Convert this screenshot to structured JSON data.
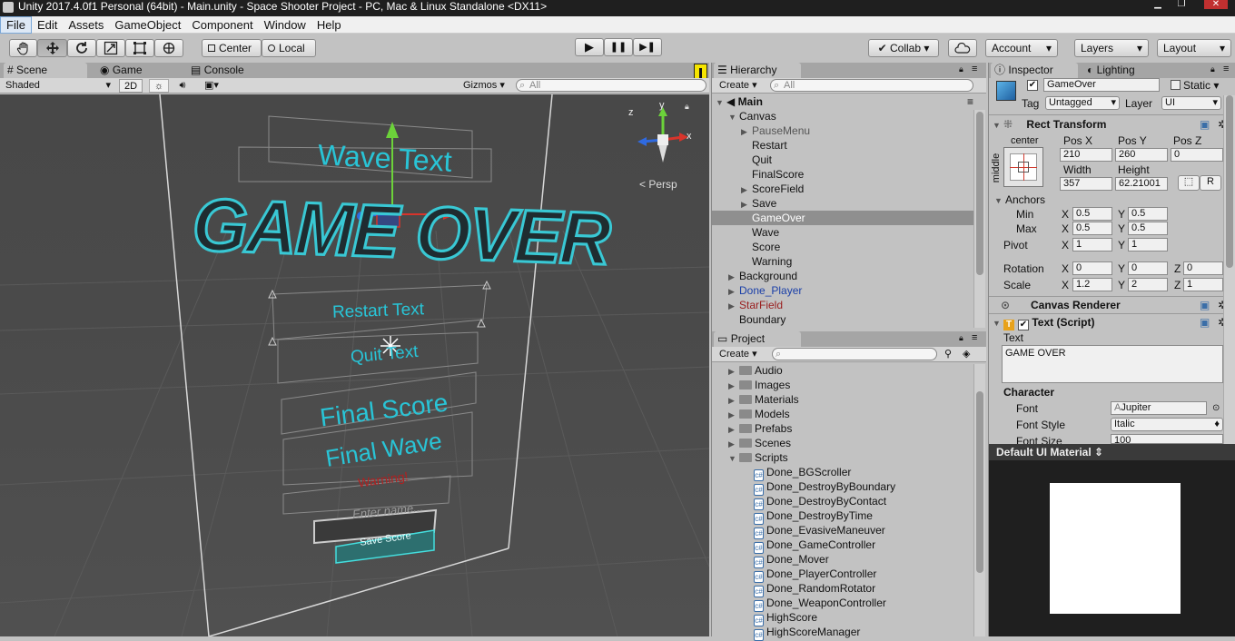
{
  "window": {
    "title": "Unity 2017.4.0f1 Personal (64bit) - Main.unity - Space Shooter Project - PC, Mac & Linux Standalone <DX11>",
    "controls": [
      "▁",
      "❐",
      "✕"
    ]
  },
  "menu": [
    "File",
    "Edit",
    "Assets",
    "GameObject",
    "Component",
    "Window",
    "Help"
  ],
  "toolbar": {
    "tools": [
      "hand-icon",
      "move-icon",
      "rotate-icon",
      "scale-icon",
      "rect-icon",
      "transform-icon"
    ],
    "pivot": "Center",
    "space": "Local",
    "play": "▶",
    "pause": "❚❚",
    "step": "▶❚",
    "collab": "Collab ▾",
    "account": "Account",
    "layers": "Layers",
    "layout": "Layout"
  },
  "scene_panel": {
    "tabs": [
      "Scene",
      "Game",
      "Console"
    ],
    "shading": "Shaded",
    "mode2d": "2D",
    "gizmos": "Gizmos",
    "search": "All",
    "persp": "Persp",
    "gizmo_axes": {
      "x": "x",
      "y": "y",
      "z": "z"
    },
    "canvas_texts": {
      "wave": "Wave Text",
      "game_over": "GAME OVER",
      "restart": "Restart Text",
      "quit": "Quit Text",
      "final_score": "Final Score",
      "final_wave": "Final Wave",
      "warning": "Warning!",
      "enter_name": "Enter name...",
      "save_score": "Save Score"
    }
  },
  "hierarchy": {
    "tab": "Hierarchy",
    "create": "Create",
    "search": "All",
    "scene": "Main",
    "items": [
      {
        "label": "Canvas",
        "indent": 1,
        "expand": "▼",
        "color": "#111111"
      },
      {
        "label": "PauseMenu",
        "indent": 2,
        "expand": "▶",
        "color": "#555555"
      },
      {
        "label": "Restart",
        "indent": 2,
        "expand": "",
        "color": "#111111"
      },
      {
        "label": "Quit",
        "indent": 2,
        "expand": "",
        "color": "#111111"
      },
      {
        "label": "FinalScore",
        "indent": 2,
        "expand": "",
        "color": "#111111"
      },
      {
        "label": "ScoreField",
        "indent": 2,
        "expand": "▶",
        "color": "#111111"
      },
      {
        "label": "Save",
        "indent": 2,
        "expand": "▶",
        "color": "#111111"
      },
      {
        "label": "GameOver",
        "indent": 2,
        "expand": "",
        "color": "#ffffff",
        "selected": true
      },
      {
        "label": "Wave",
        "indent": 2,
        "expand": "",
        "color": "#111111"
      },
      {
        "label": "Score",
        "indent": 2,
        "expand": "",
        "color": "#111111"
      },
      {
        "label": "Warning",
        "indent": 2,
        "expand": "",
        "color": "#111111"
      },
      {
        "label": "Background",
        "indent": 1,
        "expand": "▶",
        "color": "#111111"
      },
      {
        "label": "Done_Player",
        "indent": 1,
        "expand": "▶",
        "color": "#1a3fa8"
      },
      {
        "label": "StarField",
        "indent": 1,
        "expand": "▶",
        "color": "#9a2020"
      },
      {
        "label": "Boundary",
        "indent": 1,
        "expand": "",
        "color": "#111111"
      }
    ]
  },
  "project": {
    "tab": "Project",
    "create": "Create",
    "folders": [
      "Audio",
      "Images",
      "Materials",
      "Models",
      "Prefabs",
      "Scenes",
      "Scripts"
    ],
    "scripts": [
      "Done_BGScroller",
      "Done_DestroyByBoundary",
      "Done_DestroyByContact",
      "Done_DestroyByTime",
      "Done_EvasiveManeuver",
      "Done_GameController",
      "Done_Mover",
      "Done_PlayerController",
      "Done_RandomRotator",
      "Done_WeaponController",
      "HighScore",
      "HighScoreManager"
    ]
  },
  "inspector": {
    "tabs": [
      "Inspector",
      "Lighting"
    ],
    "object_name": "GameOver",
    "static": "Static",
    "tag_label": "Tag",
    "tag": "Untagged",
    "layer_label": "Layer",
    "layer": "UI",
    "rect_transform": {
      "title": "Rect Transform",
      "anchor_h": "center",
      "anchor_v": "middle",
      "pos_x_label": "Pos X",
      "pos_y_label": "Pos Y",
      "pos_z_label": "Pos Z",
      "pos_x": "210",
      "pos_y": "260",
      "pos_z": "0",
      "width_label": "Width",
      "height_label": "Height",
      "width": "357",
      "height": "62.21001",
      "anchors": "Anchors",
      "min_label": "Min",
      "max_label": "Max",
      "pivot_label": "Pivot",
      "min_x": "0.5",
      "min_y": "0.5",
      "max_x": "0.5",
      "max_y": "0.5",
      "pivot_x": "1",
      "pivot_y": "1",
      "rotation_label": "Rotation",
      "scale_label": "Scale",
      "rot_x": "0",
      "rot_y": "0",
      "rot_z": "0",
      "scale_x": "1.2",
      "scale_y": "2",
      "scale_z": "1",
      "x": "X",
      "y": "Y",
      "z": "Z",
      "r": "R"
    },
    "canvas_renderer": "Canvas Renderer",
    "text_script": {
      "title": "Text (Script)",
      "text_label": "Text",
      "text": "GAME  OVER",
      "character": "Character",
      "font_label": "Font",
      "font": "Jupiter",
      "font_style_label": "Font Style",
      "font_style": "Italic",
      "font_size_label": "Font Size",
      "font_size": "100"
    },
    "material": "Default UI Material"
  }
}
